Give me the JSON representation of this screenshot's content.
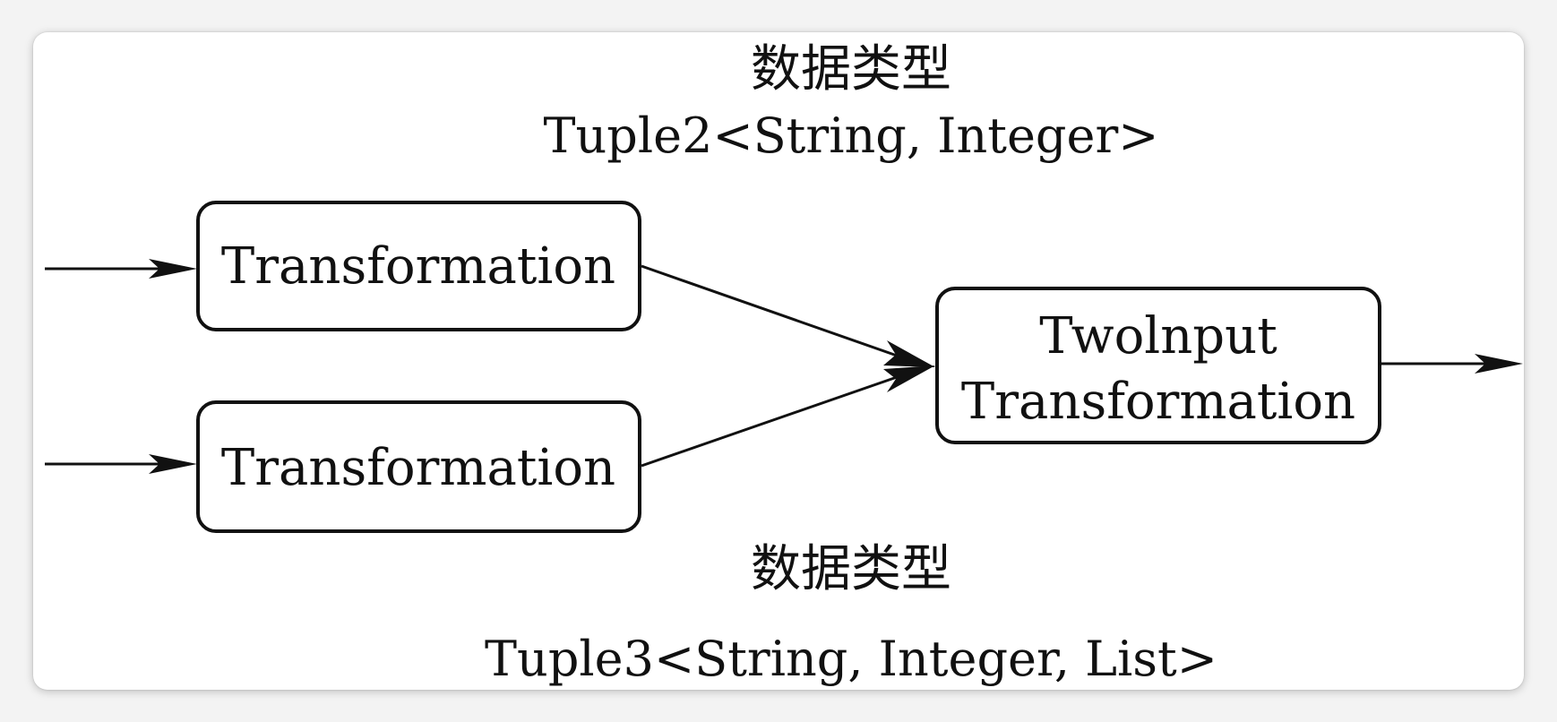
{
  "top_annotation": {
    "title": "数据类型",
    "type": "Tuple2<String, Integer>"
  },
  "bottom_annotation": {
    "title": "数据类型",
    "type": "Tuple3<String, Integer, List>"
  },
  "nodes": {
    "transformation_top": "Transformation",
    "transformation_bottom": "Transformation",
    "two_input_line1": "Twolnput",
    "two_input_line2": "Transformation"
  }
}
